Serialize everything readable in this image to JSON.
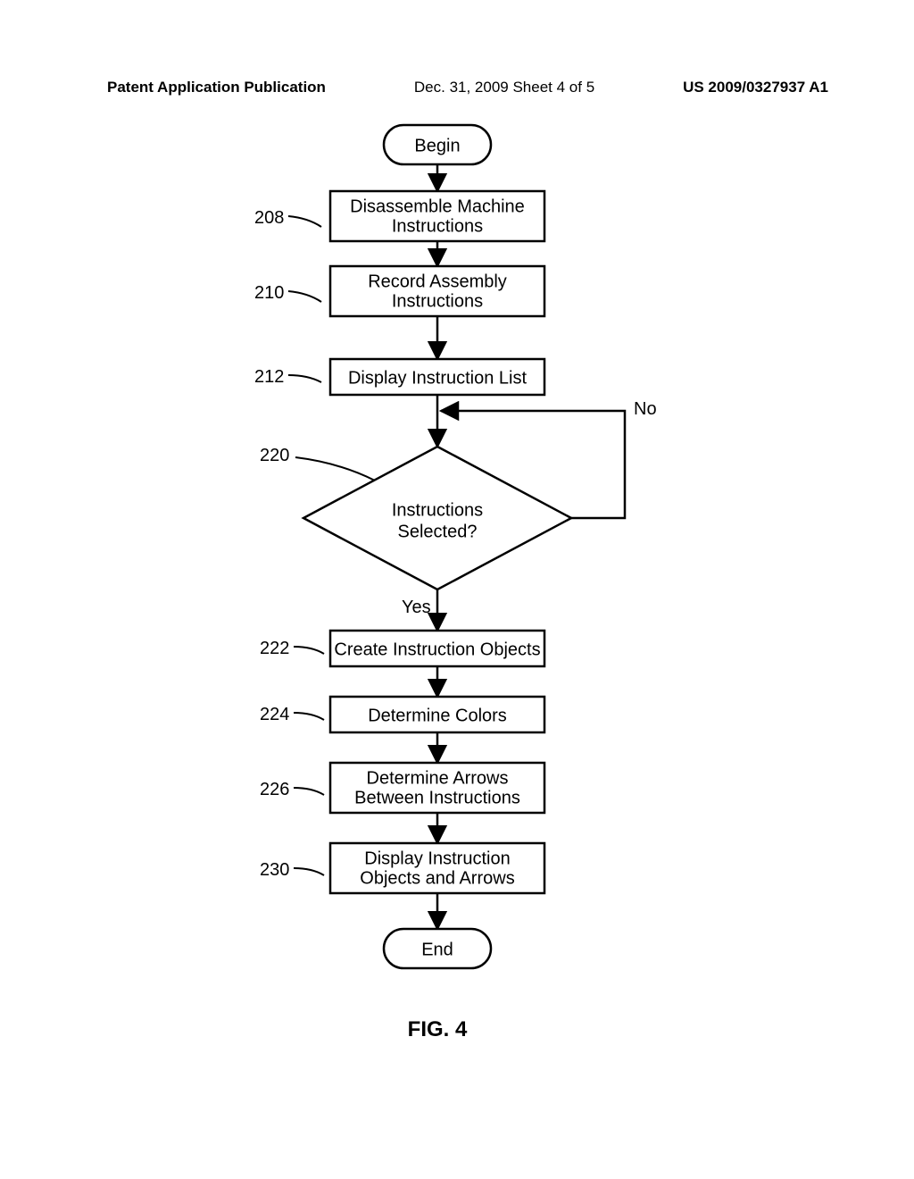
{
  "header": {
    "left": "Patent Application Publication",
    "center": "Dec. 31, 2009  Sheet 4 of 5",
    "right": "US 2009/0327937 A1"
  },
  "flowchart": {
    "start_label": "Begin",
    "end_label": "End",
    "yes_label": "Yes",
    "no_label": "No",
    "figure_label": "FIG. 4",
    "nodes": {
      "n208": {
        "ref": "208",
        "line1": "Disassemble Machine",
        "line2": "Instructions"
      },
      "n210": {
        "ref": "210",
        "line1": "Record Assembly",
        "line2": "Instructions"
      },
      "n212": {
        "ref": "212",
        "line1": "Display Instruction List"
      },
      "n220": {
        "ref": "220",
        "line1": "Instructions",
        "line2": "Selected?"
      },
      "n222": {
        "ref": "222",
        "line1": "Create Instruction Objects"
      },
      "n224": {
        "ref": "224",
        "line1": "Determine Colors"
      },
      "n226": {
        "ref": "226",
        "line1": "Determine Arrows",
        "line2": "Between Instructions"
      },
      "n230": {
        "ref": "230",
        "line1": "Display Instruction",
        "line2": "Objects and Arrows"
      }
    }
  }
}
